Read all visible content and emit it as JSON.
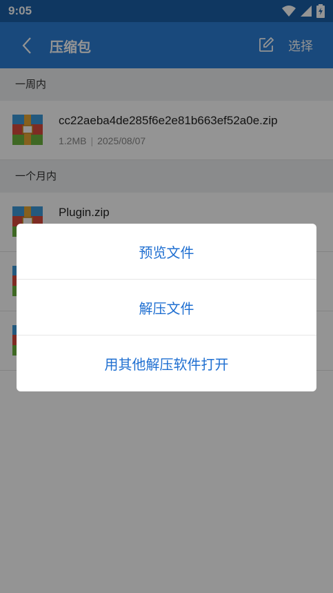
{
  "status_bar": {
    "time": "9:05"
  },
  "app_bar": {
    "title": "压缩包",
    "select_label": "选择"
  },
  "sections": [
    {
      "label": "一周内"
    },
    {
      "label": "一个月内"
    }
  ],
  "files": [
    {
      "name": "cc22aeba4de285f6e2e81b663ef52a0e.zip",
      "size": "1.2MB",
      "date": "2025/08/07"
    },
    {
      "name": "Plugin.zip",
      "size": "",
      "date": ""
    }
  ],
  "dialog": {
    "options": [
      {
        "label": "预览文件"
      },
      {
        "label": "解压文件"
      },
      {
        "label": "用其他解压软件打开"
      }
    ]
  },
  "colors": {
    "app_bar": "#2b7fd6",
    "status_bar": "#1a5fa8",
    "accent": "#1f6fd1"
  }
}
